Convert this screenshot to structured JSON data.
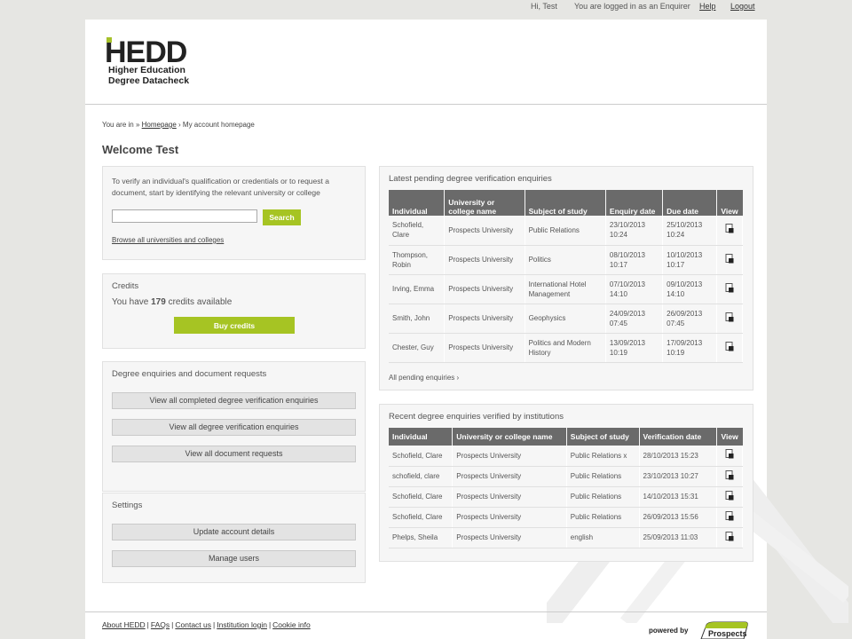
{
  "topbar": {
    "greeting": "Hi, Test",
    "status": "You are logged in as an Enquirer",
    "help": "Help",
    "logout": "Logout"
  },
  "logo": {
    "mark": "HEDD",
    "line1": "Higher Education",
    "line2": "Degree Datacheck"
  },
  "breadcrumb": {
    "prefix": "You are in »",
    "home": "Homepage",
    "arrow": "›",
    "current": "My account homepage"
  },
  "welcome": "Welcome Test",
  "verify": {
    "text_line1": "To verify an individual's qualification or credentials or to request a",
    "text_line2": "document, start by identifying the relevant university or college",
    "search_value": "",
    "search_button": "Search",
    "browse_link": "Browse all universities and colleges"
  },
  "credits": {
    "title": "Credits",
    "prefix": "You have",
    "count": "179",
    "suffix": "credits available",
    "buy_button": "Buy credits"
  },
  "enquiries": {
    "title": "Degree enquiries and document requests",
    "buttons": [
      "View all completed degree verification enquiries",
      "View all degree verification enquiries",
      "View all document requests"
    ]
  },
  "settings": {
    "title": "Settings",
    "buttons": [
      "Update account details",
      "Manage users"
    ]
  },
  "pending": {
    "title": "Latest pending degree verification enquiries",
    "headers": [
      "Individual",
      "University or college name",
      "Subject of study",
      "Enquiry date",
      "Due date",
      "View"
    ],
    "rows": [
      [
        "Schofield, Clare",
        "Prospects University",
        "Public Relations",
        "23/10/2013 10:24",
        "25/10/2013 10:24"
      ],
      [
        "Thompson, Robin",
        "Prospects University",
        "Politics",
        "08/10/2013 10:17",
        "10/10/2013 10:17"
      ],
      [
        "Irving, Emma",
        "Prospects University",
        "International Hotel Management",
        "07/10/2013 14:10",
        "09/10/2013 14:10"
      ],
      [
        "Smith, John",
        "Prospects University",
        "Geophysics",
        "24/09/2013 07:45",
        "26/09/2013 07:45"
      ],
      [
        "Chester, Guy",
        "Prospects University",
        "Politics and Modern History",
        "13/09/2013 10:19",
        "17/09/2013 10:19"
      ]
    ],
    "all_link": "All pending enquiries ›"
  },
  "recent": {
    "title": "Recent degree enquiries verified by institutions",
    "headers": [
      "Individual",
      "University or college name",
      "Subject of study",
      "Verification date",
      "View"
    ],
    "rows": [
      [
        "Schofield, Clare",
        "Prospects University",
        "Public Relations x",
        "28/10/2013 15:23"
      ],
      [
        "schofield, clare",
        "Prospects University",
        "Public Relations",
        "23/10/2013 10:27"
      ],
      [
        "Schofield, Clare",
        "Prospects University",
        "Public Relations",
        "14/10/2013 15:31"
      ],
      [
        "Schofield, Clare",
        "Prospects University",
        "Public Relations",
        "26/09/2013 15:56"
      ],
      [
        "Phelps, Sheila",
        "Prospects University",
        "english",
        "25/09/2013 11:03"
      ]
    ]
  },
  "footer": {
    "links": [
      "About HEDD",
      "FAQs",
      "Contact us",
      "Institution login",
      "Cookie info"
    ],
    "powered": "powered by",
    "brand": "Prospects"
  },
  "colors": {
    "accent": "#a6c423",
    "header_bg": "#6a6a6a",
    "panel_bg": "#f6f6f6"
  }
}
